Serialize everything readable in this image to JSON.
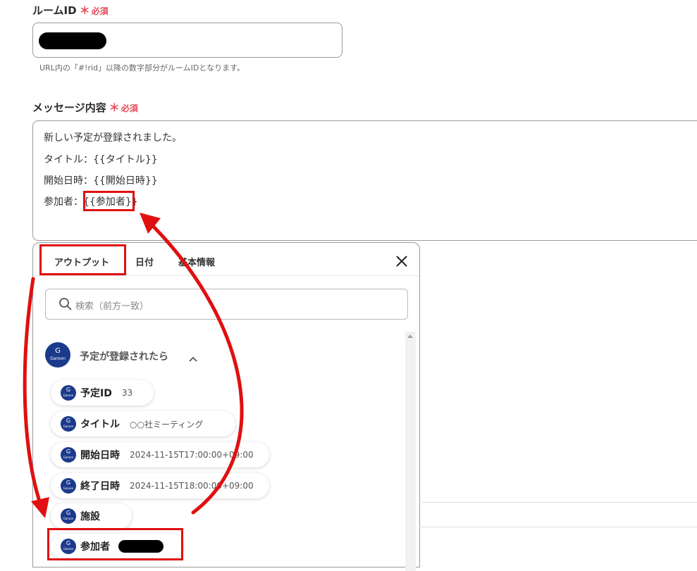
{
  "room_id": {
    "label": "ルームID",
    "required_star": "＊",
    "required_text": "必須",
    "hint": "URL内の「#!rid」以降の数字部分がルームIDとなります。"
  },
  "message": {
    "label": "メッセージ内容",
    "required_star": "＊",
    "required_text": "必須",
    "lines": [
      "新しい予定が登録されました。",
      "タイトル：{{タイトル}}",
      "開始日時：{{開始日時}}",
      "参加者：{{参加者}}"
    ],
    "line4_prefix": "参加者：",
    "line4_token": "{{参加者}}"
  },
  "panel": {
    "tabs": [
      "アウトプット",
      "日付",
      "基本情報"
    ],
    "search_placeholder": "検索（前方一致）",
    "section_title": "予定が登録されたら",
    "icon_text_top": "G",
    "icon_text_bottom": "Garoon",
    "items": [
      {
        "label": "予定ID",
        "value": "33"
      },
      {
        "label": "タイトル",
        "value": "○○社ミーティング"
      },
      {
        "label": "開始日時",
        "value": "2024-11-15T17:00:00+09:00"
      },
      {
        "label": "終了日時",
        "value": "2024-11-15T18:00:00+09:00"
      },
      {
        "label": "施設",
        "value": ""
      },
      {
        "label": "参加者",
        "value": ""
      }
    ]
  },
  "colors": {
    "required": "#e64b5a",
    "garoon_blue": "#1b3a8c",
    "annotation_red": "#e01010"
  },
  "icons": [
    "search-icon",
    "close-icon",
    "chevron-up-icon",
    "garoon-icon"
  ]
}
